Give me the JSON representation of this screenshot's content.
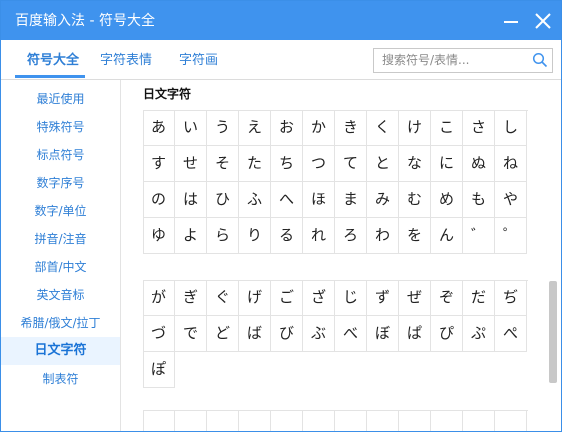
{
  "window": {
    "title": "百度输入法 - 符号大全"
  },
  "tabs": [
    {
      "label": "符号大全",
      "active": true
    },
    {
      "label": "字符表情",
      "active": false
    },
    {
      "label": "字符画",
      "active": false
    }
  ],
  "search": {
    "placeholder": "搜索符号/表情..."
  },
  "sidebar": {
    "items": [
      {
        "label": "最近使用"
      },
      {
        "label": "特殊符号"
      },
      {
        "label": "标点符号"
      },
      {
        "label": "数字序号"
      },
      {
        "label": "数字/单位"
      },
      {
        "label": "拼音/注音"
      },
      {
        "label": "部首/中文"
      },
      {
        "label": "英文音标"
      },
      {
        "label": "希腊/俄文/拉丁"
      },
      {
        "label": "日文字符",
        "active": true
      },
      {
        "label": "制表符"
      }
    ]
  },
  "content": {
    "section_title": "日文字符",
    "groups": [
      [
        "あ",
        "い",
        "う",
        "え",
        "お",
        "か",
        "き",
        "く",
        "け",
        "こ",
        "さ",
        "し",
        "す",
        "せ",
        "そ",
        "た",
        "ち",
        "つ",
        "て",
        "と",
        "な",
        "に",
        "ぬ",
        "ね",
        "の",
        "は",
        "ひ",
        "ふ",
        "へ",
        "ほ",
        "ま",
        "み",
        "む",
        "め",
        "も",
        "や",
        "ゆ",
        "よ",
        "ら",
        "り",
        "る",
        "れ",
        "ろ",
        "わ",
        "を",
        "ん",
        "゛",
        "゜"
      ],
      [
        "が",
        "ぎ",
        "ぐ",
        "げ",
        "ご",
        "ざ",
        "じ",
        "ず",
        "ぜ",
        "ぞ",
        "だ",
        "ぢ",
        "づ",
        "で",
        "ど",
        "ば",
        "び",
        "ぶ",
        "べ",
        "ぼ",
        "ぱ",
        "ぴ",
        "ぷ",
        "ぺ",
        "ぽ"
      ],
      [
        "",
        "",
        "",
        "",
        "",
        "",
        "",
        "",
        "",
        "",
        "",
        ""
      ]
    ]
  },
  "colors": {
    "titlebar": "#3f93ee",
    "accent": "#2f7fd6"
  },
  "icons": {
    "minimize": "minimize-icon",
    "close": "close-icon",
    "search": "search-icon"
  }
}
